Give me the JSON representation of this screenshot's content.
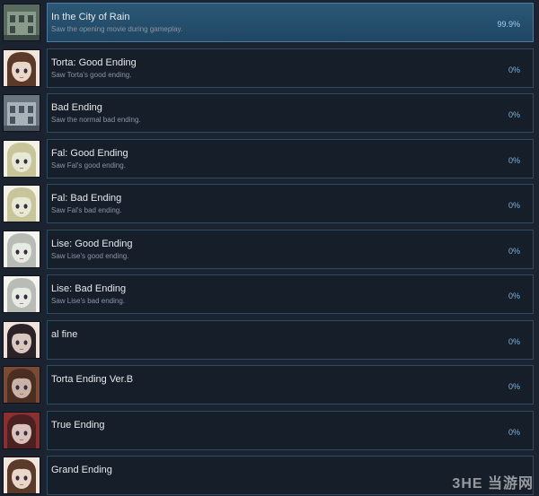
{
  "achievements": [
    {
      "title": "In the City of Rain",
      "description": "Saw the opening movie during gameplay.",
      "percent": "99.9%",
      "unlocked": true,
      "icon": "rainy-city-street-icon"
    },
    {
      "title": "Torta: Good Ending",
      "description": "Saw Torta's good ending.",
      "percent": "0%",
      "unlocked": false,
      "icon": "character-portrait-brown-hair-icon"
    },
    {
      "title": "Bad Ending",
      "description": "Saw the normal bad ending.",
      "percent": "0%",
      "unlocked": false,
      "icon": "building-facade-icon"
    },
    {
      "title": "Fal: Good Ending",
      "description": "Saw Fal's good ending.",
      "percent": "0%",
      "unlocked": false,
      "icon": "character-portrait-light-hair-icon"
    },
    {
      "title": "Fal: Bad Ending",
      "description": "Saw Fal's bad ending.",
      "percent": "0%",
      "unlocked": false,
      "icon": "character-portrait-light-hair-icon"
    },
    {
      "title": "Lise: Good Ending",
      "description": "Saw Lise's good ending.",
      "percent": "0%",
      "unlocked": false,
      "icon": "character-portrait-silver-hair-icon"
    },
    {
      "title": "Lise: Bad Ending",
      "description": "Saw Lise's bad ending.",
      "percent": "0%",
      "unlocked": false,
      "icon": "character-portrait-silver-hair-icon"
    },
    {
      "title": "al fine",
      "description": "",
      "percent": "0%",
      "unlocked": false,
      "icon": "character-portrait-dark-hair-icon"
    },
    {
      "title": "Torta Ending Ver.B",
      "description": "",
      "percent": "0%",
      "unlocked": false,
      "icon": "two-characters-portrait-icon"
    },
    {
      "title": "True Ending",
      "description": "",
      "percent": "0%",
      "unlocked": false,
      "icon": "character-portrait-dark-red-icon"
    },
    {
      "title": "Grand Ending",
      "description": "",
      "percent": "",
      "unlocked": false,
      "icon": "character-portrait-brown-hair-icon"
    }
  ],
  "colors": {
    "background": "#1b2330",
    "panel": "#161e2a",
    "panel_border": "#2f4a63",
    "unlocked_panel": "#2b5876",
    "title_text": "#e6e9ec",
    "desc_text": "#8b96a3",
    "percent_text": "#7fb4de"
  },
  "watermark": "3HE 当游网"
}
